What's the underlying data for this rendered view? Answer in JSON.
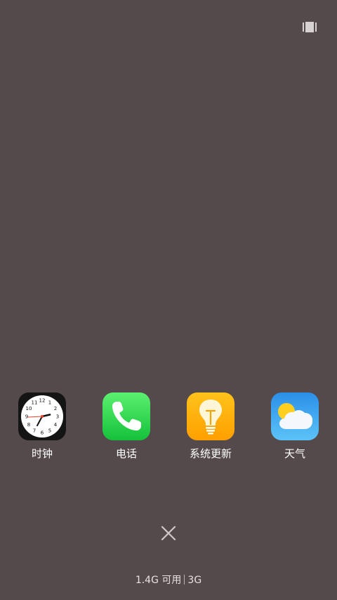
{
  "top_toggle": {
    "icon": "multi-window-icon"
  },
  "apps": [
    {
      "label": "时钟",
      "icon": "clock-icon",
      "clock_numbers": [
        "12",
        "1",
        "2",
        "3",
        "4",
        "5",
        "6",
        "7",
        "8",
        "9",
        "10",
        "11"
      ]
    },
    {
      "label": "电话",
      "icon": "phone-icon"
    },
    {
      "label": "系统更新",
      "icon": "lightbulb-icon"
    },
    {
      "label": "天气",
      "icon": "weather-icon"
    }
  ],
  "close_button": {
    "icon": "close-icon"
  },
  "memory": {
    "available": "1.4G 可用",
    "total": "3G"
  },
  "colors": {
    "background": "#544a4b",
    "phone_green": "#2fd24c",
    "update_orange": "#ffb300",
    "weather_blue": "#3fa9f5"
  }
}
